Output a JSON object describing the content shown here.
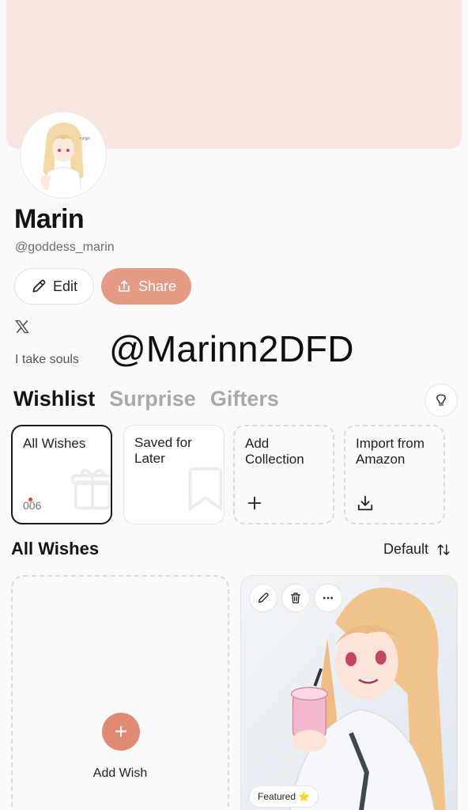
{
  "profile": {
    "name": "Marin",
    "handle": "@goddess_marin",
    "bio": "I take souls",
    "overlay_text": "@Marinn2DFD",
    "social": "x-icon"
  },
  "actions": {
    "edit_label": "Edit",
    "share_label": "Share"
  },
  "tabs": [
    {
      "label": "Wishlist",
      "active": true
    },
    {
      "label": "Surprise",
      "active": false
    },
    {
      "label": "Gifters",
      "active": false
    }
  ],
  "collections": [
    {
      "label": "All Wishes",
      "count": "006",
      "selected": true,
      "icon": "gift-icon"
    },
    {
      "label": "Saved for Later",
      "icon": "bookmark-icon"
    },
    {
      "label": "Add Collection",
      "icon": "plus-icon"
    },
    {
      "label": "Import from Amazon",
      "icon": "download-icon"
    }
  ],
  "section": {
    "title": "All Wishes",
    "sort_label": "Default"
  },
  "add_wish": {
    "label": "Add Wish"
  },
  "wish_item": {
    "badge": "Featured ⭐"
  },
  "colors": {
    "accent": "#e59a86",
    "banner": "#f9e5df"
  }
}
